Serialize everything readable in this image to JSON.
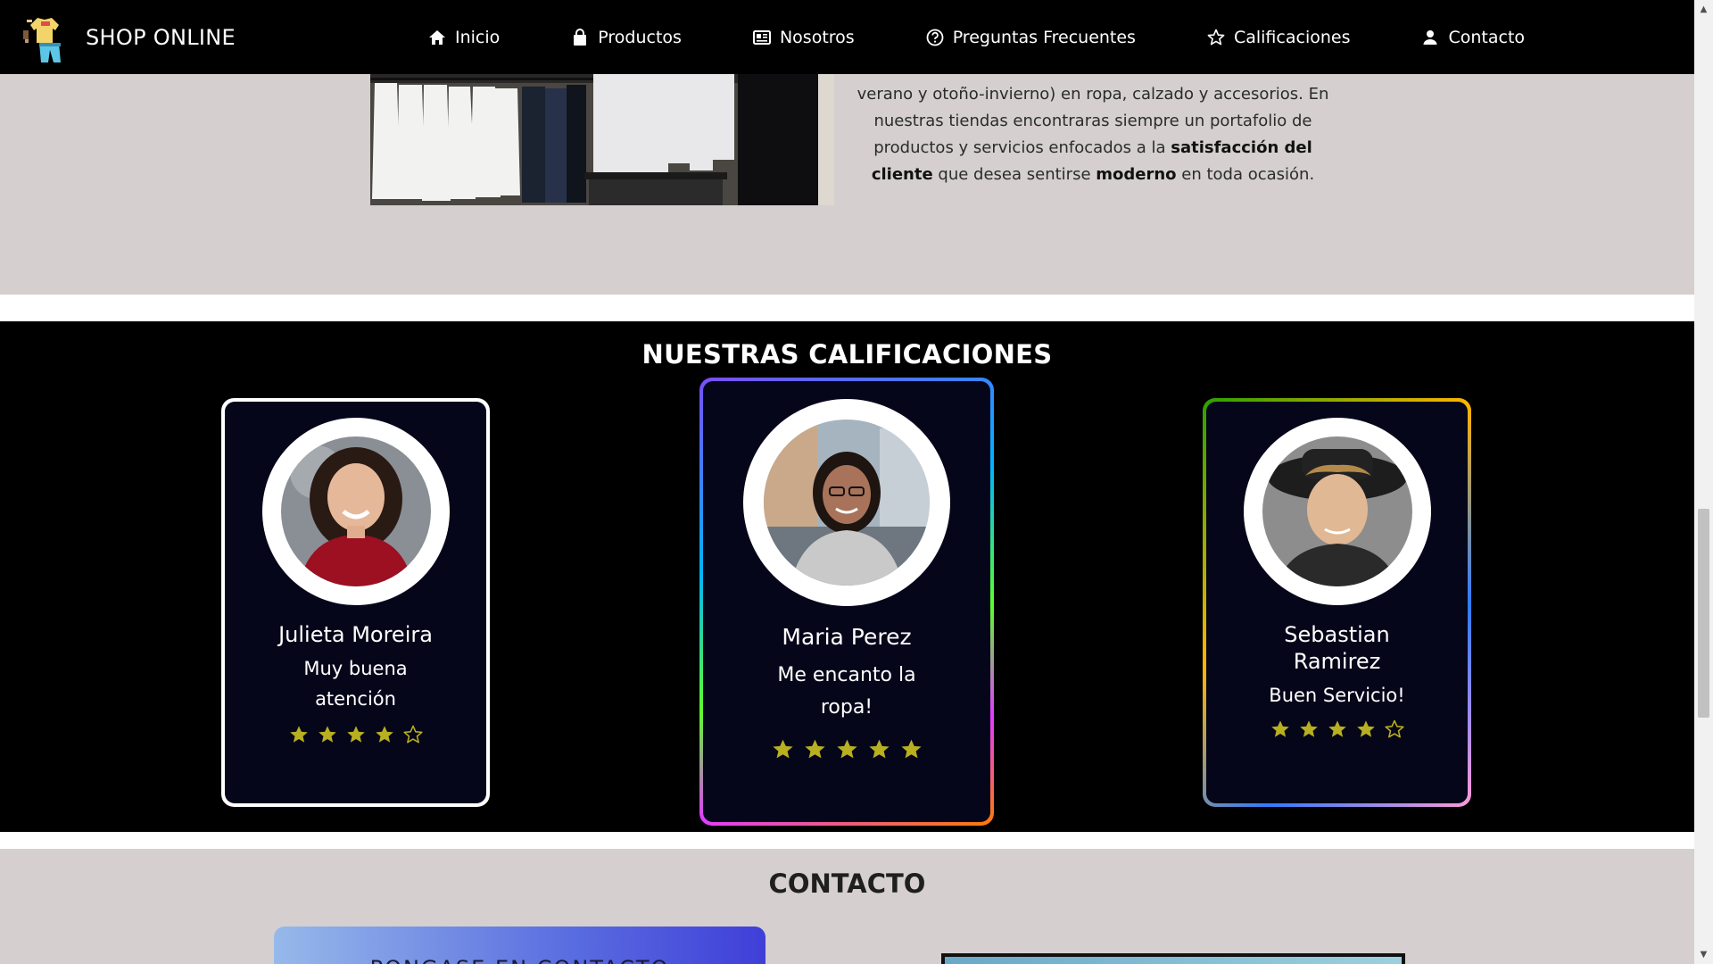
{
  "navbar": {
    "brand": "SHOP ONLINE",
    "items": [
      {
        "label": "Inicio",
        "icon": "home-icon"
      },
      {
        "label": "Productos",
        "icon": "shopping-bag-icon"
      },
      {
        "label": "Nosotros",
        "icon": "id-card-icon"
      },
      {
        "label": "Preguntas Frecuentes",
        "icon": "question-circle-icon"
      },
      {
        "label": "Calificaciones",
        "icon": "star-outline-icon"
      },
      {
        "label": "Contacto",
        "icon": "user-icon"
      }
    ]
  },
  "about": {
    "line1": "verano y otoño-invierno) en ropa, calzado y accesorios. En",
    "line2": "nuestras tiendas encontraras siempre un portafolio de",
    "line3_pre": "productos y servicios enfocados a la ",
    "line3_bold": "satisfacción del",
    "line4_bold1": "cliente",
    "line4_mid": " que desea sentirse ",
    "line4_bold2": "moderno",
    "line4_post": " en toda ocasión."
  },
  "ratings": {
    "title": "NUESTRAS CALIFICACIONES",
    "cards": [
      {
        "name": "Julieta Moreira",
        "comment": "Muy buena atención",
        "stars": 4,
        "max_stars": 5
      },
      {
        "name": "Maria Perez",
        "comment": "Me encanto la ropa!",
        "stars": 5,
        "max_stars": 5
      },
      {
        "name": "Sebastian Ramirez",
        "comment": "Buen Servicio!",
        "stars": 4,
        "max_stars": 5
      }
    ]
  },
  "contact": {
    "title": "CONTACTO",
    "card_title": "PONGASE EN CONTACTO"
  },
  "colors": {
    "navbar_bg": "#000000",
    "section_bg": "#d5cfcf",
    "ratings_bg": "#000000",
    "card_bg": "#06061a",
    "star": "#b8b021"
  }
}
